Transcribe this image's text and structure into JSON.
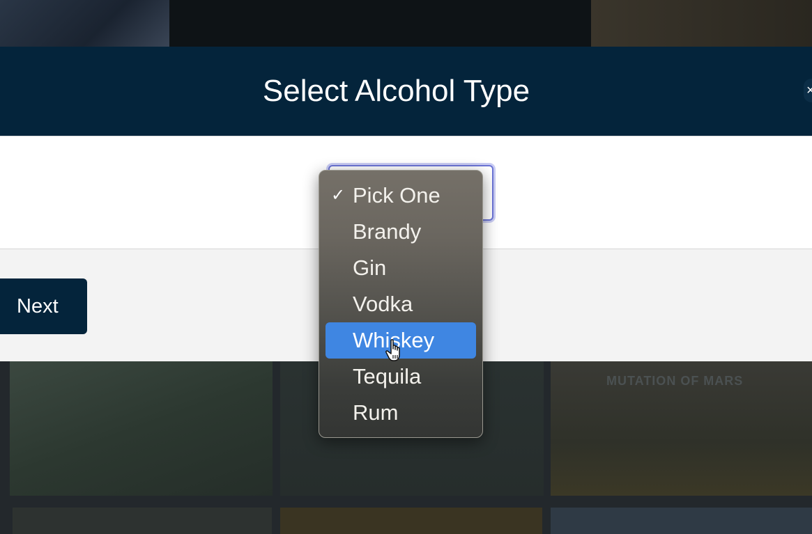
{
  "modal": {
    "title": "Select Alcohol Type",
    "close_icon": "×",
    "next_label": "Next"
  },
  "select": {
    "current_value": "Pick One",
    "options": [
      {
        "label": "Pick One",
        "checked": true
      },
      {
        "label": "Brandy"
      },
      {
        "label": "Gin"
      },
      {
        "label": "Vodka"
      },
      {
        "label": "Whiskey",
        "highlighted": true
      },
      {
        "label": "Tequila"
      },
      {
        "label": "Rum"
      }
    ],
    "checkmark": "✓"
  },
  "background": {
    "ghost_text": "MUTATION OF MARS"
  },
  "colors": {
    "header": "#04243b",
    "highlight": "#3f86e2",
    "focus_ring": "#6b74d6"
  },
  "icons": [
    "close-icon",
    "checkmark-icon",
    "pointer-cursor-icon"
  ]
}
